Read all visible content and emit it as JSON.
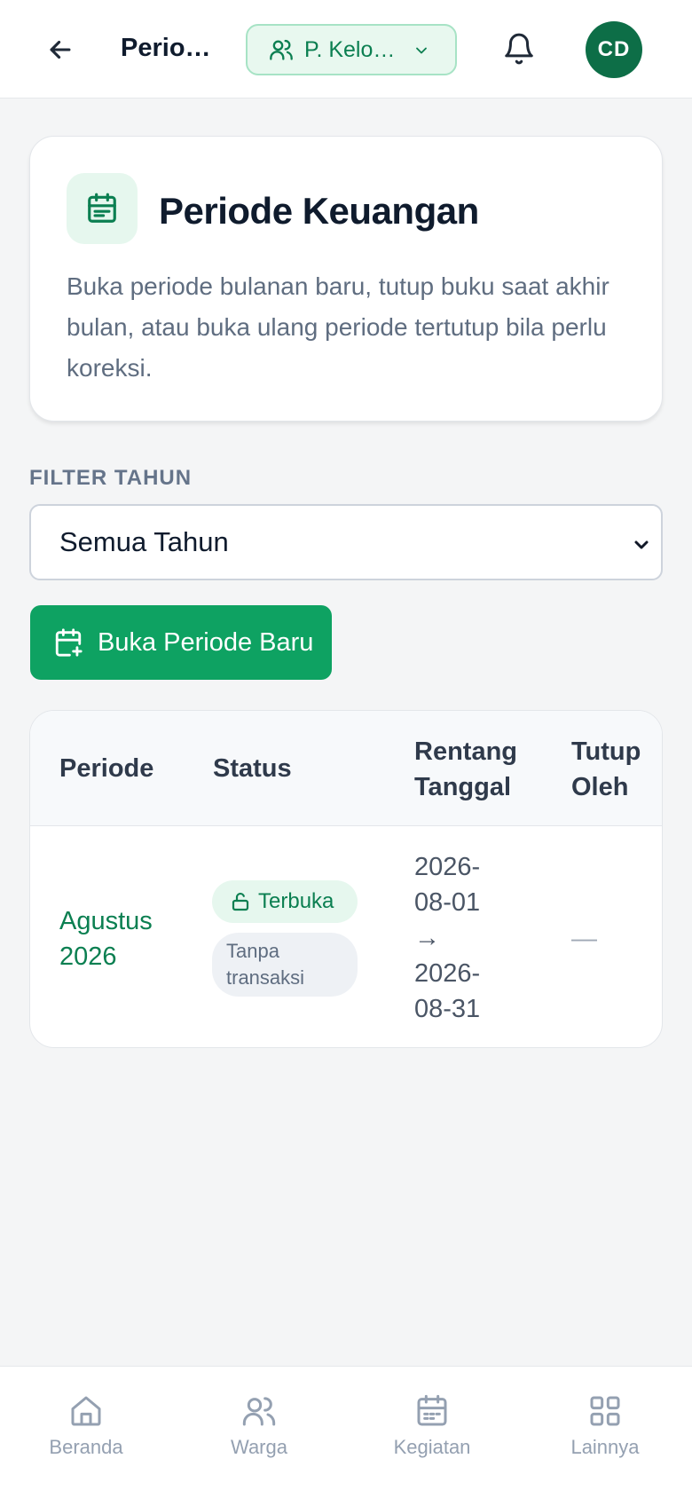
{
  "header": {
    "page_title": "Periode Keuangan",
    "group_label": "P. Kelompok",
    "avatar_initials": "CD"
  },
  "info_card": {
    "title": "Periode Keuangan",
    "description": "Buka periode bulanan baru, tutup buku saat akhir bulan, atau buka ulang periode tertutup bila perlu koreksi."
  },
  "filter": {
    "label": "FILTER TAHUN",
    "selected": "Semua Tahun"
  },
  "actions": {
    "open_period_label": "Buka Periode Baru"
  },
  "table": {
    "headers": {
      "period": "Periode",
      "status": "Status",
      "range_line1": "Rentang",
      "range_line2": "Tanggal",
      "closed_by_line1": "Tutup",
      "closed_by_line2": "Oleh"
    },
    "rows": [
      {
        "period_line1": "Agustus",
        "period_line2": "2026",
        "status": "Terbuka",
        "note_line1": "Tanpa",
        "note_line2": "transaksi",
        "range_l1": "2026-",
        "range_l2": "08-01",
        "range_l3": "→",
        "range_l4": "2026-",
        "range_l5": "08-31",
        "closed_by": "—"
      }
    ]
  },
  "bottom_nav": {
    "items": [
      {
        "label": "Beranda",
        "icon": "home-icon"
      },
      {
        "label": "Warga",
        "icon": "users-icon"
      },
      {
        "label": "Kegiatan",
        "icon": "calendar-icon"
      },
      {
        "label": "Lainnya",
        "icon": "grid-icon"
      }
    ]
  },
  "colors": {
    "brand": "#0ea262",
    "brand_dark": "#0d6e47",
    "brand_text": "#0b7f51",
    "brand_tint": "#e6f7ee"
  }
}
